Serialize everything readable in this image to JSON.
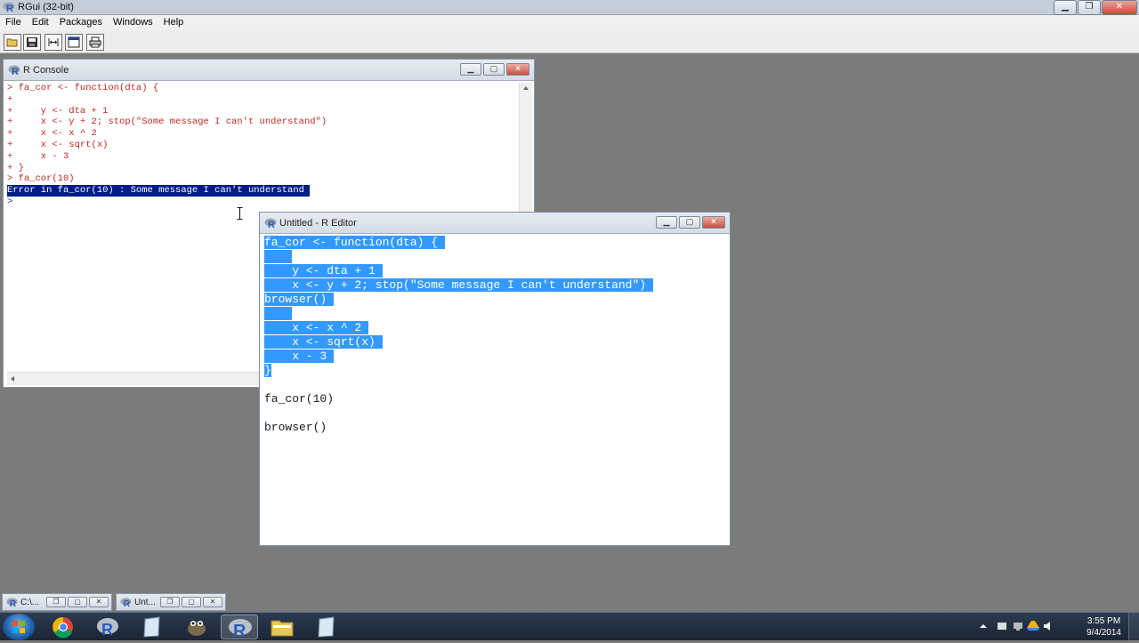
{
  "app": {
    "title": "RGui (32-bit)"
  },
  "menu": [
    "File",
    "Edit",
    "Packages",
    "Windows",
    "Help"
  ],
  "toolbar": [
    "open-script",
    "save",
    "load-workspace",
    "console-window",
    "print"
  ],
  "console": {
    "title": "R Console",
    "lines": [
      {
        "text": "> fa_cor <- function(dta) {",
        "kind": "input"
      },
      {
        "text": "+",
        "kind": "input"
      },
      {
        "text": "+     y <- dta + 1",
        "kind": "input"
      },
      {
        "text": "+     x <- y + 2; stop(\"Some message I can't understand\")",
        "kind": "input"
      },
      {
        "text": "+     x <- x ^ 2",
        "kind": "input"
      },
      {
        "text": "+     x <- sqrt(x)",
        "kind": "input"
      },
      {
        "text": "+     x - 3",
        "kind": "input"
      },
      {
        "text": "+ }",
        "kind": "input"
      },
      {
        "text": "> fa_cor(10)",
        "kind": "input"
      },
      {
        "text": "Error in fa_cor(10) : Some message I can't understand ",
        "kind": "error"
      },
      {
        "text": "> ",
        "kind": "prompt"
      }
    ]
  },
  "editor": {
    "title": "Untitled - R Editor",
    "lines": [
      {
        "text": "fa_cor <- function(dta) { ",
        "selected": true
      },
      {
        "text": "    ",
        "selected": true
      },
      {
        "text": "    y <- dta + 1 ",
        "selected": true
      },
      {
        "text": "    x <- y + 2; stop(\"Some message I can't understand\") ",
        "selected": true
      },
      {
        "text": "browser() ",
        "selected": true
      },
      {
        "text": "    ",
        "selected": true
      },
      {
        "text": "    x <- x ^ 2 ",
        "selected": true
      },
      {
        "text": "    x <- sqrt(x) ",
        "selected": true
      },
      {
        "text": "    x - 3 ",
        "selected": true
      },
      {
        "text": "}",
        "selected": true
      },
      {
        "text": "",
        "selected": false
      },
      {
        "text": "fa_cor(10)",
        "selected": false
      },
      {
        "text": "",
        "selected": false
      },
      {
        "text": "browser()",
        "selected": false
      }
    ]
  },
  "minimized": [
    {
      "label": "C:\\...",
      "icon": "r-logo-icon"
    },
    {
      "label": "Unt...",
      "icon": "r-logo-icon"
    }
  ],
  "taskbar": {
    "apps": [
      "chrome-icon",
      "r-icon",
      "notepad-icon",
      "gimp-icon",
      "rgui-icon",
      "folder-icon",
      "notepad2-icon"
    ],
    "clock_time": "3:55 PM",
    "clock_date": "9/4/2014"
  }
}
